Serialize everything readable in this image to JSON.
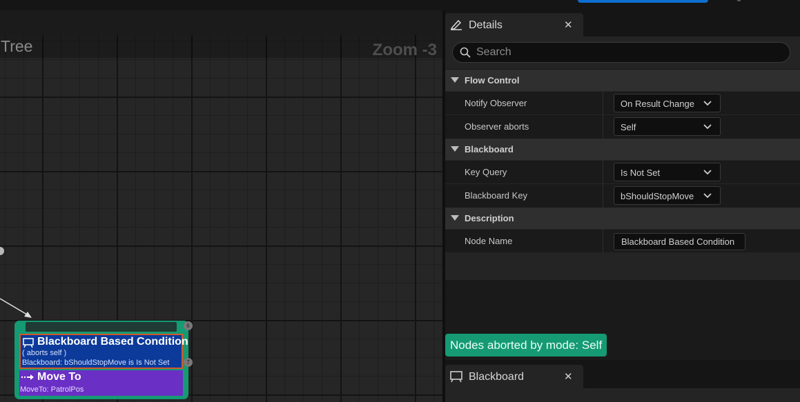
{
  "graph": {
    "title": "Tree",
    "zoom": "Zoom -3"
  },
  "node": {
    "decorator": {
      "title": "Blackboard Based Condition",
      "abort_mode": "( aborts self )",
      "description": "Blackboard: bShouldStopMove is Is Not Set",
      "icon": "decorator-icon",
      "color": "#0c3a9a"
    },
    "task": {
      "title": "Move To",
      "description": "MoveTo: PatrolPos",
      "icon": "move-to-icon",
      "color": "#6a2fc4"
    },
    "index_top": "6",
    "index_bottom": "7",
    "composite_color": "#159a74"
  },
  "details": {
    "tab_label": "Details",
    "tab_icon": "pencil-icon",
    "close_icon": "close-icon",
    "search_placeholder": "Search",
    "sections": {
      "flow_control": {
        "label": "Flow Control",
        "notify_observer": {
          "label": "Notify Observer",
          "value": "On Result Change"
        },
        "observer_aborts": {
          "label": "Observer aborts",
          "value": "Self"
        }
      },
      "blackboard": {
        "label": "Blackboard",
        "key_query": {
          "label": "Key Query",
          "value": "Is Not Set"
        },
        "blackboard_key": {
          "label": "Blackboard Key",
          "value": "bShouldStopMove"
        }
      },
      "description": {
        "label": "Description",
        "node_name": {
          "label": "Node Name",
          "value": "Blackboard Based Condition"
        }
      }
    }
  },
  "status": {
    "badge": "Nodes aborted by mode: Self",
    "color": "#159a74"
  },
  "blackboard_panel": {
    "tab_label": "Blackboard",
    "tab_icon": "blackboard-icon",
    "close_icon": "close-icon"
  }
}
